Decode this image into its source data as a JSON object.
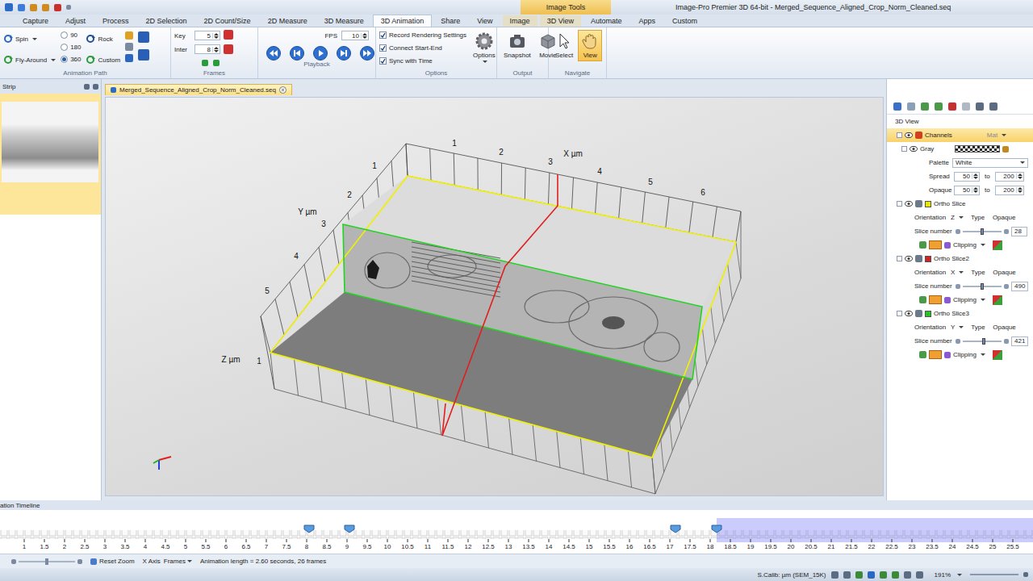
{
  "window": {
    "title": "Image-Pro Premier 3D 64-bit - Merged_Sequence_Aligned_Crop_Norm_Cleaned.seq",
    "contextual_tab": "Image Tools"
  },
  "ribbon_tabs": [
    {
      "label": "Capture",
      "selected": false,
      "contextual": false
    },
    {
      "label": "Adjust",
      "selected": false,
      "contextual": false
    },
    {
      "label": "Process",
      "selected": false,
      "contextual": false
    },
    {
      "label": "2D Selection",
      "selected": false,
      "contextual": false
    },
    {
      "label": "2D Count/Size",
      "selected": false,
      "contextual": false
    },
    {
      "label": "2D Measure",
      "selected": false,
      "contextual": false
    },
    {
      "label": "3D Measure",
      "selected": false,
      "contextual": false
    },
    {
      "label": "3D Animation",
      "selected": true,
      "contextual": false
    },
    {
      "label": "Share",
      "selected": false,
      "contextual": false
    },
    {
      "label": "View",
      "selected": false,
      "contextual": false
    },
    {
      "label": "Image",
      "selected": false,
      "contextual": true
    },
    {
      "label": "3D View",
      "selected": false,
      "contextual": true
    },
    {
      "label": "Automate",
      "selected": false,
      "contextual": false
    },
    {
      "label": "Apps",
      "selected": false,
      "contextual": false
    },
    {
      "label": "Custom",
      "selected": false,
      "contextual": false
    }
  ],
  "ribbon": {
    "animation_path": {
      "label": "Animation Path",
      "spin": "Spin",
      "fly_around": "Fly-Around",
      "rock": "Rock",
      "custom": "Custom",
      "angles": [
        {
          "label": "90",
          "selected": false
        },
        {
          "label": "180",
          "selected": false
        },
        {
          "label": "360",
          "selected": true
        }
      ]
    },
    "frames": {
      "label": "Frames",
      "key_label": "Key",
      "key": "5",
      "inter_label": "Inter",
      "inter": "8"
    },
    "playback": {
      "label": "Playback",
      "fps_label": "FPS",
      "fps": "10"
    },
    "options": {
      "label": "Options",
      "button": "Options",
      "checks": [
        {
          "label": "Record Rendering Settings",
          "checked": true
        },
        {
          "label": "Connect Start-End",
          "checked": true
        },
        {
          "label": "Sync with Time",
          "checked": true
        }
      ]
    },
    "output": {
      "label": "Output",
      "buttons": [
        "Snapshot",
        "Movie"
      ]
    },
    "navigate": {
      "label": "Navigate",
      "buttons": [
        {
          "label": "Select",
          "selected": false
        },
        {
          "label": "View",
          "selected": true
        }
      ]
    }
  },
  "strip": {
    "title": "Strip"
  },
  "document": {
    "tab": "Merged_Sequence_Aligned_Crop_Norm_Cleaned.seq"
  },
  "view3d": {
    "x_label": "X µm",
    "y_label": "Y µm",
    "z_label": "Z µm",
    "x_ticks": [
      "1",
      "2",
      "3",
      "4",
      "5",
      "6"
    ],
    "y_ticks": [
      "1",
      "2",
      "3",
      "4",
      "5"
    ],
    "z_ticks": [
      "1"
    ]
  },
  "panel": {
    "title": "3D View",
    "channels": "Channels",
    "faded": "Mat",
    "channel": {
      "name": "Gray",
      "palette_label": "Palette",
      "palette": "White",
      "ranges": [
        {
          "label": "Spread",
          "from": "50",
          "to_label": "to",
          "to": "200"
        },
        {
          "label": "Opaque",
          "from": "50",
          "to_label": "to",
          "to": "200"
        }
      ]
    },
    "labels": {
      "orientation": "Orientation",
      "type": "Type",
      "slice_number": "Slice number",
      "clipping": "Clipping"
    },
    "slices": [
      {
        "name": "Ortho Slice",
        "color": "#e6e600",
        "orientation": "Z",
        "type": "Opaque",
        "slice": "28",
        "level": 0.5
      },
      {
        "name": "Ortho Slice2",
        "color": "#d42020",
        "orientation": "X",
        "type": "Opaque",
        "slice": "490",
        "level": 0.5
      },
      {
        "name": "Ortho Slice3",
        "color": "#22c322",
        "orientation": "Y",
        "type": "Opaque",
        "slice": "421",
        "level": 0.55
      }
    ]
  },
  "timeline": {
    "title": "ation Timeline",
    "ticks": [
      "1",
      "1.5",
      "2",
      "2.5",
      "3",
      "3.5",
      "4",
      "4.5",
      "5",
      "5.5",
      "6",
      "6.5",
      "7",
      "7.5",
      "8",
      "8.5",
      "9",
      "9.5",
      "10",
      "10.5",
      "11",
      "11.5",
      "12",
      "12.5",
      "13",
      "13.5",
      "14",
      "14.5",
      "15",
      "15.5",
      "16",
      "16.5",
      "17",
      "17.5",
      "18",
      "18.5",
      "19",
      "19.5",
      "20",
      "20.5",
      "21",
      "21.5",
      "22",
      "22.5",
      "23",
      "23.5",
      "24",
      "24.5",
      "25",
      "25.5"
    ],
    "keyframes": [
      8.06,
      9.06,
      17.14,
      18.16
    ],
    "selection_start": 18.16,
    "zoom_level": 0.5,
    "reset_zoom": "Reset Zoom",
    "x_axis_label": "X Axis",
    "x_axis": "Frames",
    "length": "Animation length = 2.60 seconds, 26 frames"
  },
  "status_bar": {
    "calibration": "S.Calib: µm (SEM_15K)",
    "zoom": "191%"
  }
}
